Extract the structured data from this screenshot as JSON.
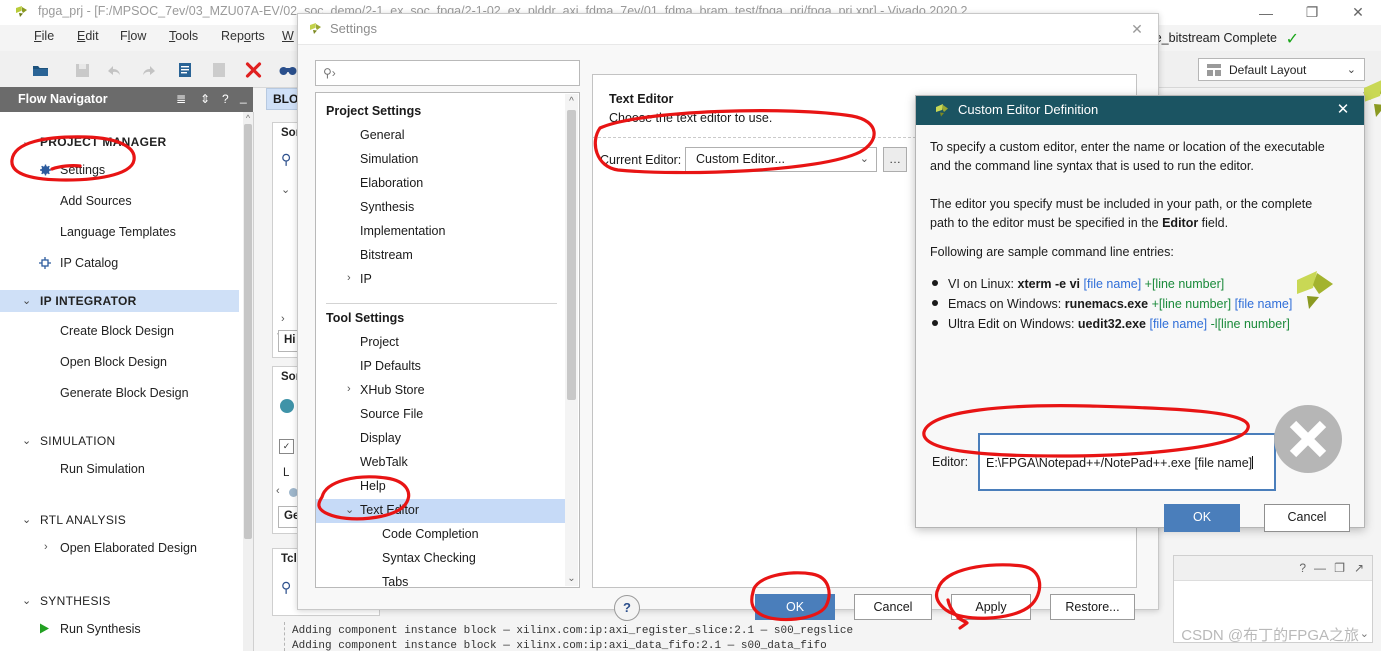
{
  "window": {
    "title": "fpga_prj - [F:/MPSOC_7ev/03_MZU07A-EV/02_soc_demo/2-1_ex_soc_fpga/2-1-02_ex_plddr_axi_fdma_7ev/01_fdma_bram_test/fpga_prj/fpga_prj.xpr] - Vivado 2020.2",
    "minimize": "—",
    "maximize": "❐",
    "close": "✕"
  },
  "menubar": [
    {
      "label": "File",
      "mnemonic": "F"
    },
    {
      "label": "Edit",
      "mnemonic": "E"
    },
    {
      "label": "Flow",
      "mnemonic": "l"
    },
    {
      "label": "Tools",
      "mnemonic": "T"
    },
    {
      "label": "Reports",
      "mnemonic": "o"
    },
    {
      "label": "W",
      "mnemonic": "W"
    }
  ],
  "toolbar_icons": [
    "open-folder-icon",
    "save-icon",
    "undo-icon",
    "redo-icon",
    "copy-icon",
    "paste-icon",
    "delete-x-icon",
    "binoculars-icon"
  ],
  "flow_navigator": {
    "title": "Flow Navigator",
    "header_icons": [
      "collapse-all-icon",
      "expand-all-icon",
      "help-icon",
      "minimize-icon"
    ],
    "items": [
      {
        "label": "PROJECT MANAGER",
        "type": "group",
        "expanded": true,
        "selected": false
      },
      {
        "label": "Settings",
        "type": "item",
        "icon": "gear-icon"
      },
      {
        "label": "Add Sources",
        "type": "item",
        "icon": ""
      },
      {
        "label": "Language Templates",
        "type": "item",
        "icon": ""
      },
      {
        "label": "IP Catalog",
        "type": "item",
        "icon": "ip-catalog-icon"
      },
      {
        "label": "IP INTEGRATOR",
        "type": "group",
        "expanded": true,
        "selected": true
      },
      {
        "label": "Create Block Design",
        "type": "item",
        "icon": ""
      },
      {
        "label": "Open Block Design",
        "type": "item",
        "icon": ""
      },
      {
        "label": "Generate Block Design",
        "type": "item",
        "icon": ""
      },
      {
        "label": "SIMULATION",
        "type": "group",
        "expanded": true,
        "selected": false
      },
      {
        "label": "Run Simulation",
        "type": "item",
        "icon": ""
      },
      {
        "label": "RTL ANALYSIS",
        "type": "group",
        "expanded": true,
        "selected": false
      },
      {
        "label": "Open Elaborated Design",
        "type": "item",
        "icon": "chevron-right-icon"
      },
      {
        "label": "SYNTHESIS",
        "type": "group",
        "expanded": true,
        "selected": false
      },
      {
        "label": "Run Synthesis",
        "type": "item",
        "icon": "run-play-icon"
      }
    ]
  },
  "background_panels": {
    "block_design_tab": "BLO",
    "sources_panel_1": "Sor",
    "sources_panel_2": "Sor",
    "tcl_panel": "Tcl",
    "hier_button": "Hi",
    "gen_button": "Ge",
    "lang_label": "L",
    "tcl_lines": [
      "Adding component instance block — xilinx.com:ip:axi_register_slice:2.1 — s00_regslice",
      "Adding component instance block — xilinx.com:ip:axi_data_fifo:2.1 — s00_data_fifo"
    ]
  },
  "right_status": {
    "run_status": "write_bitstream Complete",
    "check_icon": "✓",
    "layout_label": "Default Layout",
    "close_icon": "✕",
    "panel_icons": [
      "?",
      "—",
      "❐",
      "↗"
    ],
    "watermark": "CSDN @布丁的FPGA之旅"
  },
  "settings_dialog": {
    "title": "Settings",
    "close": "✕",
    "search_placeholder": "",
    "search_icon": "search-icon",
    "tree": {
      "project_settings_header": "Project Settings",
      "project_settings": [
        {
          "label": "General",
          "expandable": false
        },
        {
          "label": "Simulation",
          "expandable": false
        },
        {
          "label": "Elaboration",
          "expandable": false
        },
        {
          "label": "Synthesis",
          "expandable": false
        },
        {
          "label": "Implementation",
          "expandable": false
        },
        {
          "label": "Bitstream",
          "expandable": false
        },
        {
          "label": "IP",
          "expandable": true
        }
      ],
      "tool_settings_header": "Tool Settings",
      "tool_settings": [
        {
          "label": "Project",
          "expandable": false,
          "indent": 0
        },
        {
          "label": "IP Defaults",
          "expandable": false,
          "indent": 0
        },
        {
          "label": "XHub Store",
          "expandable": true,
          "indent": 0
        },
        {
          "label": "Source File",
          "expandable": false,
          "indent": 0
        },
        {
          "label": "Display",
          "expandable": false,
          "indent": 0
        },
        {
          "label": "WebTalk",
          "expandable": false,
          "indent": 0
        },
        {
          "label": "Help",
          "expandable": false,
          "indent": 0
        },
        {
          "label": "Text Editor",
          "expandable": true,
          "indent": 0,
          "selected": true
        },
        {
          "label": "Code Completion",
          "expandable": false,
          "indent": 1
        },
        {
          "label": "Syntax Checking",
          "expandable": false,
          "indent": 1
        },
        {
          "label": "Tabs",
          "expandable": false,
          "indent": 1
        }
      ]
    },
    "text_editor_pane": {
      "heading": "Text Editor",
      "subheading": "Choose the text editor to use.",
      "current_editor_label": "Current Editor:",
      "current_editor_value": "Custom Editor...",
      "browse_button": "…"
    },
    "help_button": "?",
    "buttons": {
      "ok": "OK",
      "cancel": "Cancel",
      "apply": "Apply",
      "restore": "Restore..."
    }
  },
  "custom_editor_dialog": {
    "title": "Custom Editor Definition",
    "close": "✕",
    "paragraph1": "To specify a custom editor, enter the name or location of the executable and the command line syntax that is used to run the editor.",
    "paragraph2_pre": "The editor you specify must be included in your path, or the complete path to the editor must be specified in the ",
    "paragraph2_bold": "Editor",
    "paragraph2_post": " field.",
    "samples_intro": "Following are sample command line entries:",
    "samples": [
      {
        "prefix": "VI on Linux: ",
        "cmd": "xterm -e vi",
        "file": " [file name]",
        "line": " +[line number]",
        "tail": ""
      },
      {
        "prefix": "Emacs on Windows: ",
        "cmd": "runemacs.exe",
        "line": " +[line number]",
        "file": " [file name]",
        "tail": ""
      },
      {
        "prefix": "Ultra Edit on Windows: ",
        "cmd": "uedit32.exe",
        "file": " [file name]",
        "line": " -l[line number]",
        "tail": ""
      }
    ],
    "editor_label": "Editor:",
    "editor_value": "E:\\FPGA\\Notepad++/NotePad++.exe [file name]",
    "ok": "OK",
    "cancel": "Cancel"
  },
  "annotations": {
    "color": "#e81414",
    "shapes": [
      "ellipse-around-settings-nav-item",
      "ellipse-around-current-editor-row",
      "ellipse-around-text-editor-tree-item",
      "ellipse-around-editor-input-field",
      "ellipse-around-ok-button",
      "ellipse-with-arrow-around-apply-button"
    ]
  },
  "colors": {
    "accent_blue": "#4a7ebb",
    "teal_titlebar": "#1b5462",
    "selection_blue": "#c6daf7",
    "flow_nav_header": "#6b6b6b",
    "annotation_red": "#e81414",
    "file_name_blue": "#2f6ed8",
    "line_number_green": "#1a8a3a",
    "success_green": "#19a519"
  }
}
